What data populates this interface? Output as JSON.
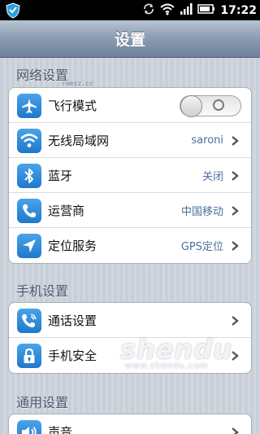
{
  "status_bar": {
    "time": "17:22",
    "icons": [
      "shield-icon",
      "sync-icon",
      "wifi-icon",
      "signal-icon",
      "battery-icon"
    ]
  },
  "header": {
    "title": "设置"
  },
  "sections": {
    "network": {
      "title": "网络设置",
      "watermark": "reesz.cc",
      "items": [
        {
          "label": "飞行模式",
          "icon": "airplane-icon",
          "toggle": "off"
        },
        {
          "label": "无线局域网",
          "icon": "wifi-icon",
          "value": "saroni"
        },
        {
          "label": "蓝牙",
          "icon": "bluetooth-icon",
          "value": "关闭"
        },
        {
          "label": "运营商",
          "icon": "phone-icon",
          "value": "中国移动"
        },
        {
          "label": "定位服务",
          "icon": "location-icon",
          "value": "GPS定位"
        }
      ]
    },
    "phone": {
      "title": "手机设置",
      "items": [
        {
          "label": "通话设置",
          "icon": "call-settings-icon"
        },
        {
          "label": "手机安全",
          "icon": "lock-icon"
        }
      ]
    },
    "general": {
      "title": "通用设置",
      "items": [
        {
          "label": "声音",
          "icon": "speaker-icon"
        }
      ]
    }
  },
  "brand": {
    "name": "shendu",
    "url": "www.shendu.com"
  },
  "colors": {
    "accent": "#1f78cc",
    "value_text": "#4b6f9c",
    "title_bar": "#8a9cb2"
  }
}
